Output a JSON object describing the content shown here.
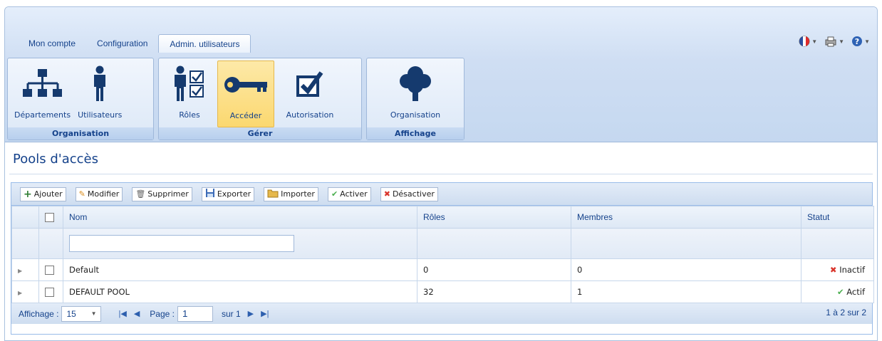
{
  "ribbon": {
    "tabs": [
      "Mon compte",
      "Configuration",
      "Admin. utilisateurs"
    ],
    "active_tab": "Admin. utilisateurs",
    "groups": [
      {
        "label": "Organisation",
        "buttons": [
          {
            "label": "Départements",
            "icon": "org-chart-icon"
          },
          {
            "label": "Utilisateurs",
            "icon": "user-icon"
          }
        ]
      },
      {
        "label": "Gérer",
        "buttons": [
          {
            "label": "Rôles",
            "icon": "user-checklist-icon"
          },
          {
            "label": "Accéder",
            "icon": "key-icon"
          },
          {
            "label": "Autorisation",
            "icon": "checkbox-icon"
          }
        ]
      },
      {
        "label": "Affichage",
        "buttons": [
          {
            "label": "Organisation",
            "icon": "tree-icon"
          }
        ]
      }
    ]
  },
  "page": {
    "title": "Pools d'accès"
  },
  "toolbar": {
    "add": "Ajouter",
    "edit": "Modifier",
    "delete": "Supprimer",
    "export": "Exporter",
    "import": "Importer",
    "activate": "Activer",
    "deactivate": "Désactiver"
  },
  "grid": {
    "columns": [
      "Nom",
      "Rôles",
      "Membres",
      "Statut"
    ],
    "rows": [
      {
        "name": "Default",
        "roles": "0",
        "members": "0",
        "status": "Inactif"
      },
      {
        "name": "DEFAULT POOL",
        "roles": "32",
        "members": "1",
        "status": "Actif"
      }
    ]
  },
  "pager": {
    "display_label": "Affichage :",
    "page_size": "15",
    "page_label": "Page :",
    "page": "1",
    "of_label": "sur 1",
    "info": "1 à 2 sur 2"
  },
  "colors": {
    "accent": "#15428b",
    "active": "#4caf50",
    "inactive": "#d9342b"
  }
}
